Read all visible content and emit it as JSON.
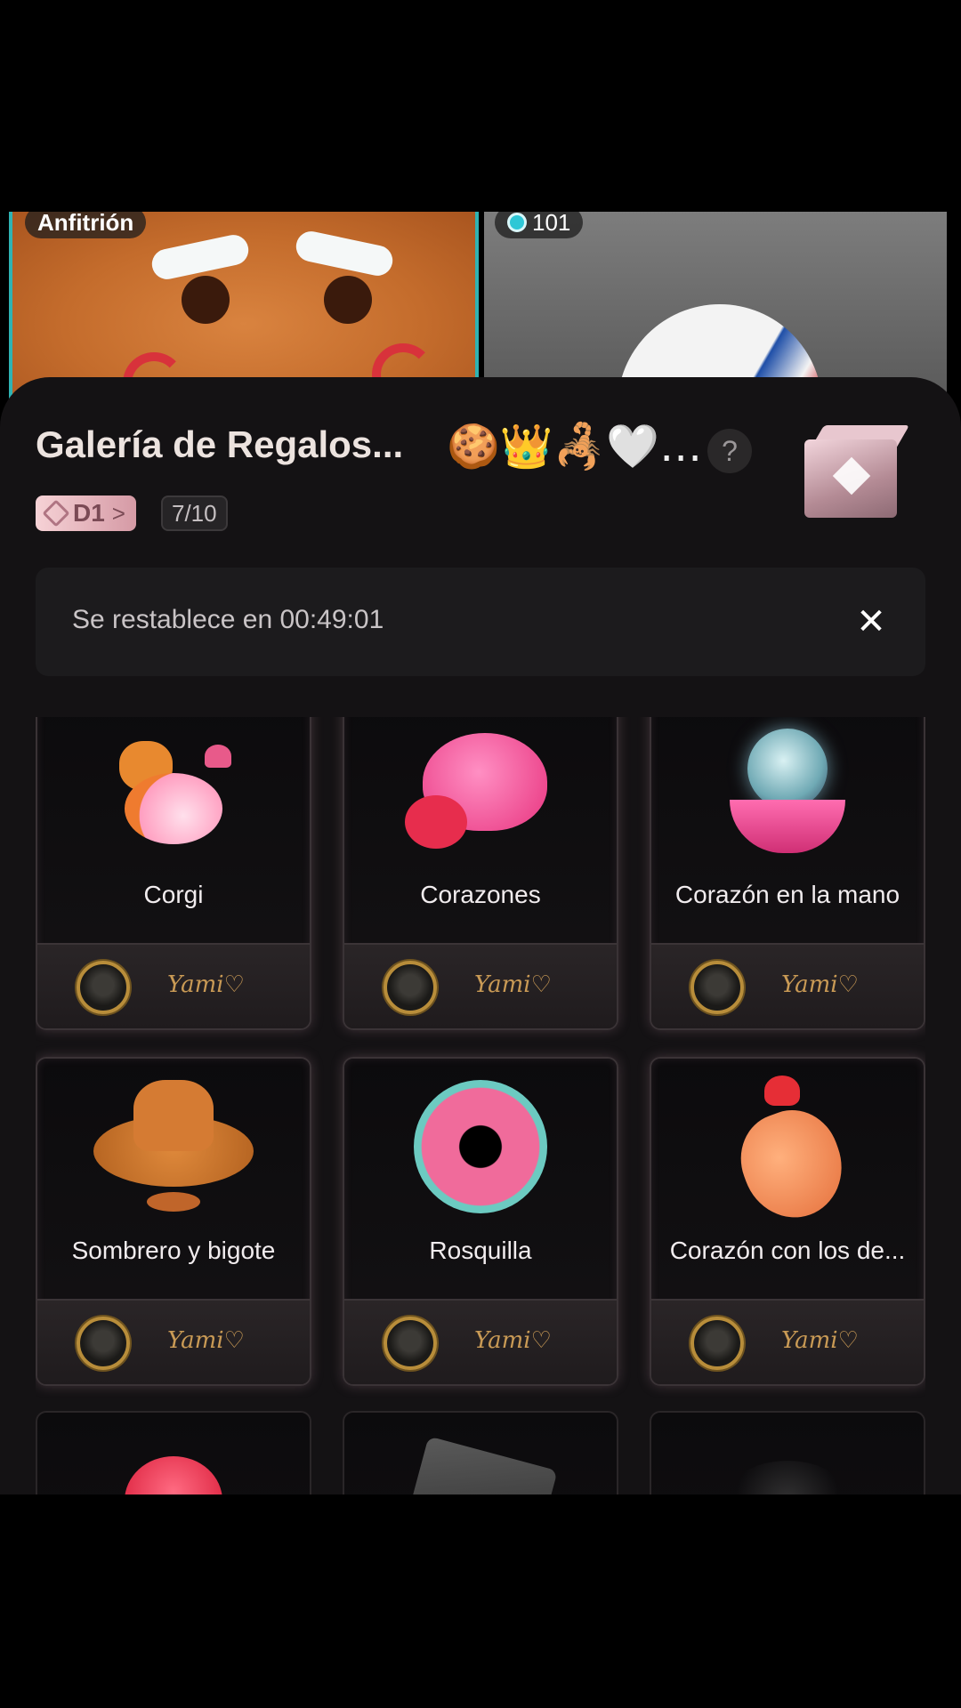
{
  "video": {
    "host_label": "Anfitrión",
    "guest_count": "101"
  },
  "sheet": {
    "title": "Galería de Regalos...",
    "emojis": "🍪👑🦂🤍…",
    "help": "?",
    "level_badge": "D1",
    "level_chevron": ">",
    "progress": "7/10",
    "reset_text": "Se restablece en 00:49:01",
    "close_glyph": "✕"
  },
  "gifts": [
    {
      "name": "Corgi",
      "sender": "Yami♡",
      "icon": "corgi-icon"
    },
    {
      "name": "Corazones",
      "sender": "Yami♡",
      "icon": "hearts-icon"
    },
    {
      "name": "Corazón en la mano",
      "sender": "Yami♡",
      "icon": "heart-in-hand-icon"
    },
    {
      "name": "Sombrero y bigote",
      "sender": "Yami♡",
      "icon": "hat-mustache-icon"
    },
    {
      "name": "Rosquilla",
      "sender": "Yami♡",
      "icon": "donut-icon"
    },
    {
      "name": "Corazón con los de...",
      "sender": "Yami♡",
      "icon": "finger-heart-icon"
    },
    {
      "name": "",
      "sender": "",
      "icon": "rose-icon"
    },
    {
      "name": "",
      "sender": "",
      "icon": "tiktok-box-icon"
    },
    {
      "name": "",
      "sender": "",
      "icon": "mystery-gift-icon"
    }
  ]
}
